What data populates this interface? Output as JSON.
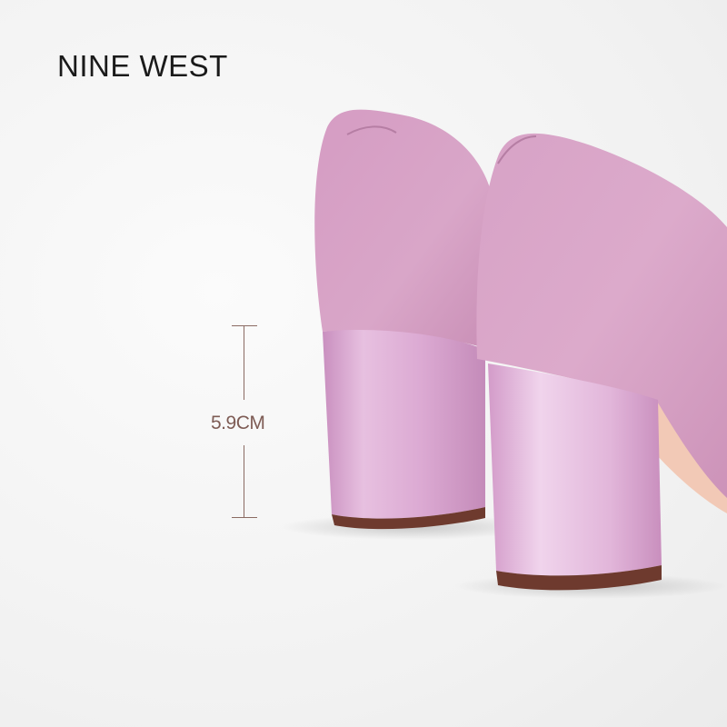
{
  "brand": {
    "name": "NINE WEST"
  },
  "product": {
    "heel_height_label": "5.9CM",
    "colors": {
      "suede": "#d9a2c9",
      "heel": "#e3b4da",
      "sole": "#6e3a2e",
      "measure": "#8a6a62"
    }
  }
}
